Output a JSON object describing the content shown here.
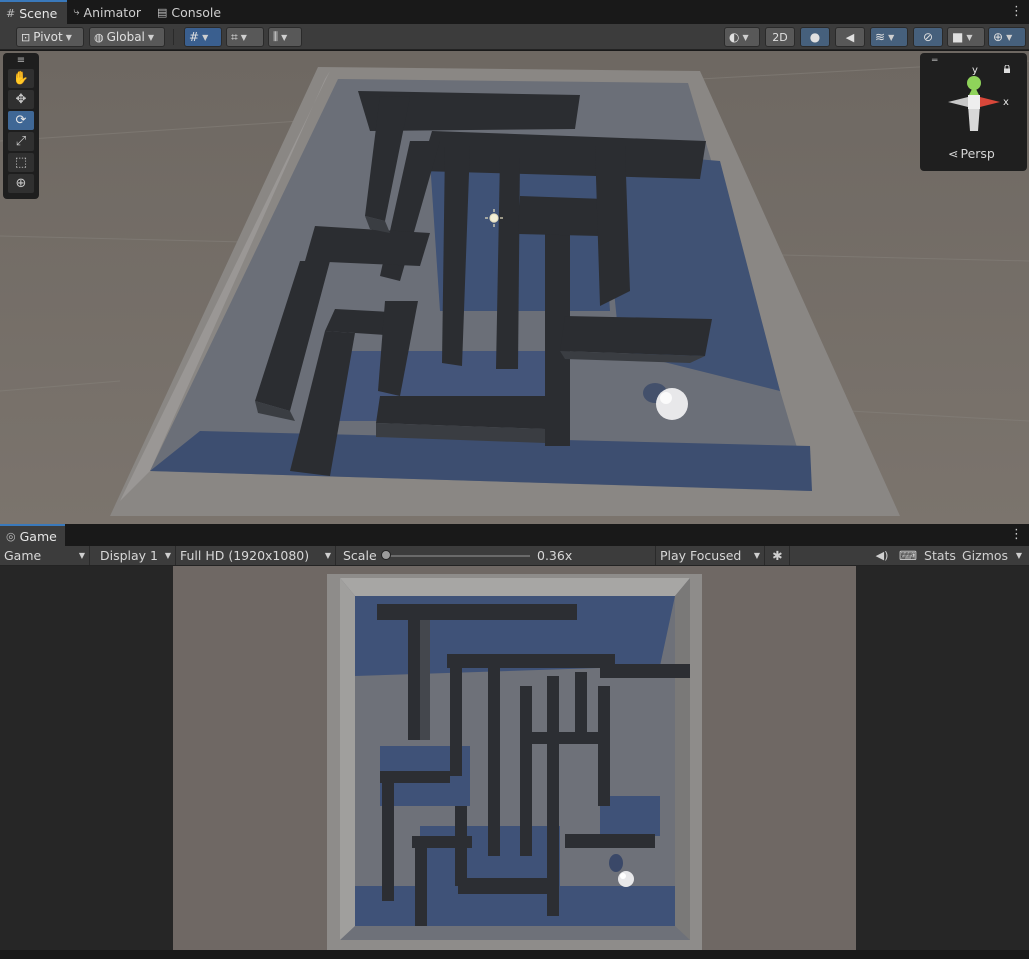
{
  "scene_tabs": [
    {
      "label": "Scene",
      "icon": "grid-icon"
    },
    {
      "label": "Animator",
      "icon": "animator-icon"
    },
    {
      "label": "Console",
      "icon": "console-icon"
    }
  ],
  "toolbar": {
    "pivot": "Pivot",
    "global": "Global",
    "two_d": "2D"
  },
  "gizmo": {
    "persp": "Persp",
    "axis_y": "y",
    "axis_x": "x"
  },
  "game_tab": {
    "label": "Game",
    "icon": "gamepad-icon"
  },
  "game_toolbar": {
    "view_select": "Game",
    "display": "Display 1",
    "resolution": "Full HD (1920x1080)",
    "scale_label": "Scale",
    "scale_value": "0.36x",
    "scale_fraction": 0.36,
    "play_mode": "Play Focused",
    "stats": "Stats",
    "gizmos": "Gizmos"
  },
  "colors": {
    "accent": "#3a79bb",
    "tool_selected": "#3f6795"
  }
}
